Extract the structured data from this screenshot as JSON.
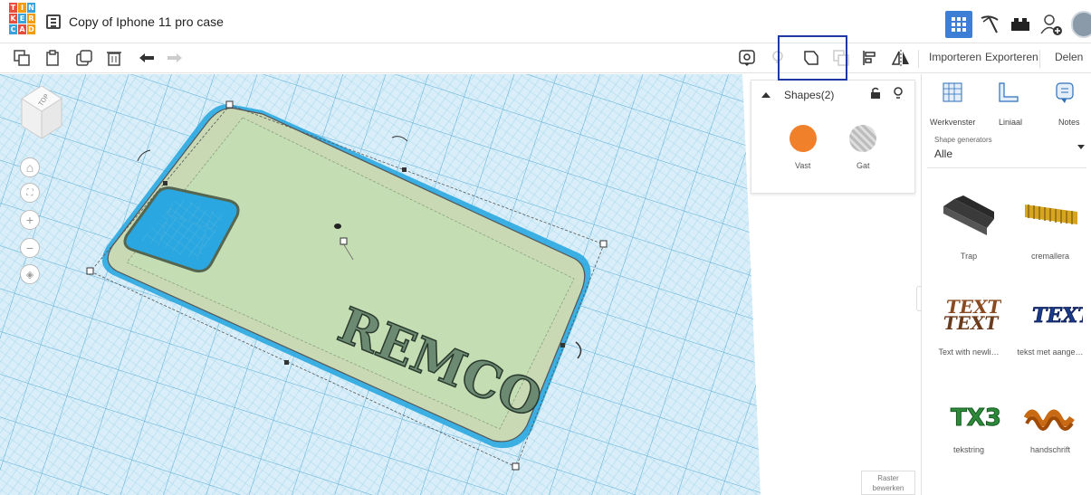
{
  "app": {
    "logo_letters": [
      "T",
      "I",
      "N",
      "K",
      "E",
      "R",
      "C",
      "A",
      "D"
    ],
    "logo_colors": [
      "#e84c3d",
      "#f39c12",
      "#3ba3dc",
      "#e84c3d",
      "#3ba3dc",
      "#f39c12",
      "#3ba3dc",
      "#e84c3d",
      "#f39c12"
    ],
    "title": "Copy of Iphone 11 pro case",
    "accent": "#3d7ed6"
  },
  "toolbar": {
    "left_tools": [
      "copy-icon",
      "paste-icon",
      "duplicate-icon",
      "delete-icon",
      "undo-icon",
      "redo-icon"
    ],
    "right_tools": [
      "note-icon",
      "light-icon",
      "group-icon",
      "ungroup-icon",
      "align-icon",
      "mirror-icon"
    ],
    "import_label": "Importeren",
    "export_label": "Exporteren",
    "share_label": "Delen"
  },
  "inspector": {
    "title": "Shapes(2)",
    "solid_label": "Vast",
    "hole_label": "Gat",
    "solid_color": "#f0802a"
  },
  "right_panel": {
    "tools": [
      {
        "label": "Werkvenster",
        "icon": "workplane-icon"
      },
      {
        "label": "Liniaal",
        "icon": "ruler-icon"
      },
      {
        "label": "Notes",
        "icon": "notes-icon"
      }
    ],
    "shape_generators_label": "Shape generators",
    "shape_generators_value": "Alle",
    "shapes": [
      {
        "label": "Trap",
        "icon": "trap-icon"
      },
      {
        "label": "cremallera",
        "icon": "cremallera-icon"
      },
      {
        "label": "Text with newli…",
        "icon": "text-newline-icon"
      },
      {
        "label": "tekst met aange…",
        "icon": "text-custom-icon"
      },
      {
        "label": "tekstring",
        "icon": "tekstring-icon"
      },
      {
        "label": "handschrift",
        "icon": "handschrift-icon"
      }
    ]
  },
  "workplane": {
    "engraved_text": "REMCO",
    "viewcube_label": "TOP",
    "grid_edit_label_1": "Raster",
    "grid_edit_label_2": "bewerken"
  }
}
